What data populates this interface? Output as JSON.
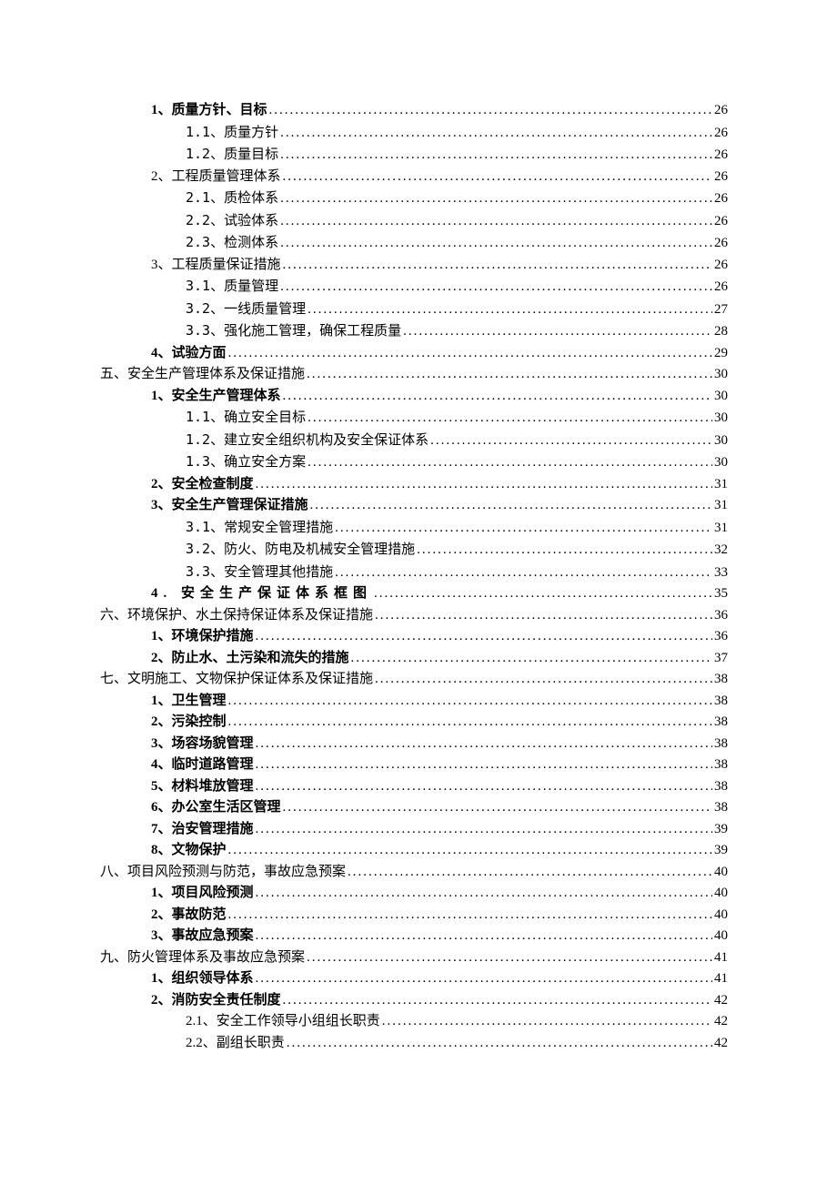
{
  "toc": [
    {
      "level": 1,
      "bold": true,
      "label": "1、质量方针、目标",
      "page": "26"
    },
    {
      "level": 2,
      "bold": false,
      "label": "1.1、质量方针",
      "page": "26",
      "mono": true
    },
    {
      "level": 2,
      "bold": false,
      "label": "1.2、质量目标",
      "page": "26",
      "mono": true
    },
    {
      "level": 1,
      "bold": false,
      "label": "2、工程质量管理体系",
      "page": "26"
    },
    {
      "level": 2,
      "bold": false,
      "label": "2.1、质检体系",
      "page": "26",
      "mono": true
    },
    {
      "level": 2,
      "bold": false,
      "label": "2.2、试验体系",
      "page": "26",
      "mono": true
    },
    {
      "level": 2,
      "bold": false,
      "label": "2.3、检测体系",
      "page": "26",
      "mono": true
    },
    {
      "level": 1,
      "bold": false,
      "label": "3、工程质量保证措施",
      "page": "26"
    },
    {
      "level": 2,
      "bold": false,
      "label": "3.1、质量管理",
      "page": "26",
      "mono": true
    },
    {
      "level": 2,
      "bold": false,
      "label": "3.2、一线质量管理",
      "page": "27",
      "mono": true
    },
    {
      "level": 2,
      "bold": false,
      "label": "3.3、强化施工管理，确保工程质量",
      "page": "28",
      "mono": true
    },
    {
      "level": 1,
      "bold": true,
      "label": "4、试验方面",
      "page": "29"
    },
    {
      "level": 0,
      "bold": false,
      "label": "五、安全生产管理体系及保证措施",
      "page": "30"
    },
    {
      "level": 1,
      "bold": true,
      "label": "1、安全生产管理体系",
      "page": "30"
    },
    {
      "level": 2,
      "bold": false,
      "label": "1.1、确立安全目标",
      "page": "30",
      "mono": true
    },
    {
      "level": 2,
      "bold": false,
      "label": "1.2、建立安全组织机构及安全保证体系",
      "page": "30",
      "mono": true
    },
    {
      "level": 2,
      "bold": false,
      "label": "1.3、确立安全方案",
      "page": "30",
      "mono": true
    },
    {
      "level": 1,
      "bold": true,
      "label": "2、安全检查制度",
      "page": "31"
    },
    {
      "level": 1,
      "bold": true,
      "label": "3、安全生产管理保证措施",
      "page": "31"
    },
    {
      "level": 2,
      "bold": false,
      "label": "3.1、常规安全管理措施",
      "page": "31",
      "mono": true
    },
    {
      "level": 2,
      "bold": false,
      "label": "3.2、防火、防电及机械安全管理措施",
      "page": "32",
      "mono": true
    },
    {
      "level": 2,
      "bold": false,
      "label": "3.3、安全管理其他措施",
      "page": "33",
      "mono": true
    },
    {
      "level": 1,
      "bold": true,
      "label": "4. 安全生产保证体系框图",
      "page": "35",
      "spaced": true
    },
    {
      "level": 0,
      "bold": false,
      "label": "六、环境保护、水土保持保证体系及保证措施",
      "page": "36"
    },
    {
      "level": 1,
      "bold": true,
      "label": "1、环境保护措施",
      "page": "36"
    },
    {
      "level": 1,
      "bold": true,
      "label": "2、防止水、土污染和流失的措施",
      "page": "37"
    },
    {
      "level": 0,
      "bold": false,
      "label": "七、文明施工、文物保护保证体系及保证措施",
      "page": "38"
    },
    {
      "level": 1,
      "bold": true,
      "label": "1、卫生管理",
      "page": "38"
    },
    {
      "level": 1,
      "bold": true,
      "label": "2、污染控制",
      "page": "38"
    },
    {
      "level": 1,
      "bold": true,
      "label": "3、场容场貌管理",
      "page": "38"
    },
    {
      "level": 1,
      "bold": true,
      "label": "4、临时道路管理",
      "page": "38"
    },
    {
      "level": 1,
      "bold": true,
      "label": "5、材料堆放管理",
      "page": "38"
    },
    {
      "level": 1,
      "bold": true,
      "label": "6、办公室生活区管理",
      "page": "38"
    },
    {
      "level": 1,
      "bold": true,
      "label": "7、治安管理措施",
      "page": "39"
    },
    {
      "level": 1,
      "bold": true,
      "label": "8、文物保护",
      "page": "39"
    },
    {
      "level": 0,
      "bold": false,
      "label": "八、项目风险预测与防范，事故应急预案",
      "page": "40"
    },
    {
      "level": 1,
      "bold": true,
      "label": "1、项目风险预测",
      "page": "40"
    },
    {
      "level": 1,
      "bold": true,
      "label": "2、事故防范",
      "page": "40"
    },
    {
      "level": 1,
      "bold": true,
      "label": "3、事故应急预案",
      "page": "40"
    },
    {
      "level": 0,
      "bold": false,
      "label": "九、防火管理体系及事故应急预案",
      "page": "41"
    },
    {
      "level": 1,
      "bold": true,
      "label": "1、组织领导体系",
      "page": "41"
    },
    {
      "level": 1,
      "bold": true,
      "label": "2、消防安全责任制度",
      "page": "42"
    },
    {
      "level": 2,
      "bold": false,
      "label": "2.1、安全工作领导小组组长职责",
      "page": "42"
    },
    {
      "level": 2,
      "bold": false,
      "label": "2.2、副组长职责",
      "page": "42"
    }
  ]
}
